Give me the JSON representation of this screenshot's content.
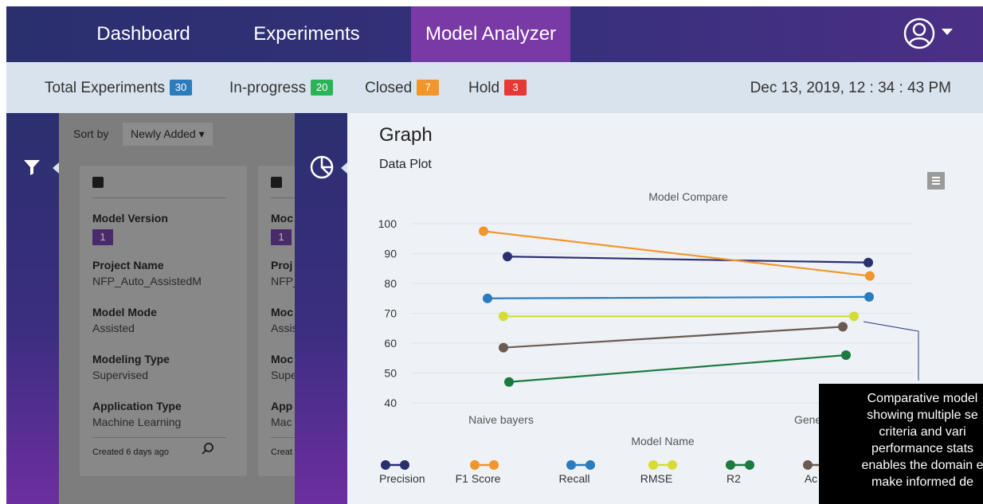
{
  "nav": {
    "items": [
      "Dashboard",
      "Experiments",
      "Model Analyzer"
    ],
    "active": "Model Analyzer",
    "user_icon": "user-circle-icon"
  },
  "status": {
    "total_label": "Total Experiments",
    "total": "30",
    "inprogress_label": "In-progress",
    "inprogress": "20",
    "closed_label": "Closed",
    "closed": "7",
    "hold_label": "Hold",
    "hold": "3",
    "datetime": "Dec 13, 2019, 12 : 34 : 43 PM",
    "colors": {
      "total": "#2b7bbf",
      "inprogress": "#2bb35a",
      "closed": "#f2962b",
      "hold": "#e53935"
    }
  },
  "filter_icon": "filter-icon",
  "chart_icon": "pie-chart-icon",
  "sort": {
    "label": "Sort by",
    "value": "Newly Added"
  },
  "card": {
    "model_version_label": "Model Version",
    "model_version": "1",
    "project_name_label": "Project Name",
    "project_name": "NFP_Auto_AssistedM",
    "model_mode_label": "Model Mode",
    "model_mode": "Assisted",
    "modeling_type_label": "Modeling Type",
    "modeling_type": "Supervised",
    "application_type_label": "Application Type",
    "application_type": "Machine Learning",
    "created": "Created 6 days ago",
    "search_icon": "search-icon"
  },
  "card2": {
    "model_version_label": "Moc",
    "model_version": "1",
    "project_name_label": "Proj",
    "project_name": "NFP_",
    "model_mode_label": "Moc",
    "model_mode": "Assis",
    "modeling_type_label": "Moc",
    "modeling_type": "Supe",
    "application_type_label": "App",
    "application_type": "Mac",
    "created": "Creat"
  },
  "graph": {
    "title": "Graph",
    "subtitle": "Data Plot",
    "menu_icon": "menu-icon"
  },
  "chart_data": {
    "type": "line",
    "title": "Model Compare",
    "xlabel": "Model Name",
    "ylabel": "",
    "ylim": [
      40,
      100
    ],
    "yticks": [
      100,
      90,
      80,
      70,
      60,
      50,
      40
    ],
    "categories": [
      "Naive bayers",
      "Generalized Lin"
    ],
    "series": [
      {
        "name": "Precision",
        "color": "#2a2f6e",
        "values": [
          89,
          87
        ]
      },
      {
        "name": "F1 Score",
        "color": "#f2962b",
        "values": [
          97.5,
          82.5
        ]
      },
      {
        "name": "Recall",
        "color": "#2b7bbf",
        "values": [
          75,
          75.5
        ]
      },
      {
        "name": "RMSE",
        "color": "#d6dc36",
        "values": [
          69,
          69
        ]
      },
      {
        "name": "R2",
        "color": "#1b7a3e",
        "values": [
          47,
          56
        ]
      },
      {
        "name": "Ac",
        "color": "#6b5a52",
        "values": [
          58.5,
          65.5
        ]
      }
    ],
    "grid": true,
    "legend": "bottom"
  },
  "tooltip": {
    "lines": [
      "Comparative model",
      "showing multiple se",
      "criteria and vari",
      "performance stats",
      "enables the domain e",
      "make informed de"
    ]
  }
}
